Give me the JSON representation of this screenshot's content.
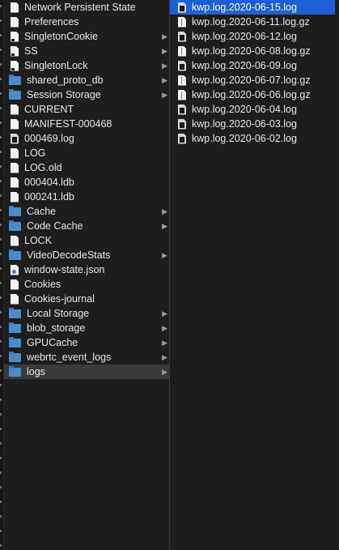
{
  "sidebar": {
    "items": [
      {
        "label": "Network Persistent State",
        "icon": "document-icon",
        "kind": "doc"
      },
      {
        "label": "Preferences",
        "icon": "document-icon",
        "kind": "doc"
      },
      {
        "label": "SingletonCookie",
        "icon": "alias-icon",
        "kind": "doc sym",
        "chevron": "▶"
      },
      {
        "label": "SS",
        "icon": "alias-icon",
        "kind": "doc sym",
        "chevron": "▶"
      },
      {
        "label": "SingletonLock",
        "icon": "alias-icon",
        "kind": "doc sym",
        "chevron": "▶"
      },
      {
        "label": "shared_proto_db",
        "icon": "folder-icon",
        "kind": "folder",
        "chevron": "▶"
      },
      {
        "label": "Session Storage",
        "icon": "folder-icon",
        "kind": "folder",
        "chevron": "▶"
      },
      {
        "label": "CURRENT",
        "icon": "document-icon",
        "kind": "doc"
      },
      {
        "label": "MANIFEST-000468",
        "icon": "document-icon",
        "kind": "doc"
      },
      {
        "label": "000469.log",
        "icon": "log-file-icon",
        "kind": "logfile"
      },
      {
        "label": "LOG",
        "icon": "document-icon",
        "kind": "doc"
      },
      {
        "label": "LOG.old",
        "icon": "document-icon",
        "kind": "doc"
      },
      {
        "label": "000404.ldb",
        "icon": "document-icon",
        "kind": "doc"
      },
      {
        "label": "000241.ldb",
        "icon": "document-icon",
        "kind": "doc"
      },
      {
        "label": "Cache",
        "icon": "folder-icon",
        "kind": "folder",
        "chevron": "▶"
      },
      {
        "label": "Code Cache",
        "icon": "folder-icon",
        "kind": "folder",
        "chevron": "▶"
      },
      {
        "label": "LOCK",
        "icon": "document-icon",
        "kind": "doc"
      },
      {
        "label": "VideoDecodeStats",
        "icon": "folder-icon",
        "kind": "folder",
        "chevron": "▶"
      },
      {
        "label": "window-state.json",
        "icon": "json-file-icon",
        "kind": "doc json"
      },
      {
        "label": "Cookies",
        "icon": "document-icon",
        "kind": "doc"
      },
      {
        "label": "Cookies-journal",
        "icon": "document-icon",
        "kind": "doc"
      },
      {
        "label": "Local Storage",
        "icon": "folder-icon",
        "kind": "folder",
        "chevron": "▶"
      },
      {
        "label": "blob_storage",
        "icon": "folder-icon",
        "kind": "folder",
        "chevron": "▶"
      },
      {
        "label": "GPUCache",
        "icon": "folder-icon",
        "kind": "folder",
        "chevron": "▶"
      },
      {
        "label": "webrtc_event_logs",
        "icon": "folder-icon",
        "kind": "folder",
        "chevron": "▶"
      },
      {
        "label": "logs",
        "icon": "folder-icon",
        "kind": "folder",
        "chevron": "▶",
        "selected": true
      }
    ]
  },
  "logs_column": {
    "items": [
      {
        "label": "kwp.log.2020-06-15.log",
        "icon": "log-file-icon",
        "kind": "logfile",
        "active": true
      },
      {
        "label": "kwp.log.2020-06-11.log.gz",
        "icon": "archive-icon",
        "kind": "doc gz"
      },
      {
        "label": "kwp.log.2020-06-12.log",
        "icon": "log-file-icon",
        "kind": "logfile"
      },
      {
        "label": "kwp.log.2020-06-08.log.gz",
        "icon": "archive-icon",
        "kind": "doc gz"
      },
      {
        "label": "kwp.log.2020-06-09.log",
        "icon": "log-file-icon",
        "kind": "logfile"
      },
      {
        "label": "kwp.log.2020-06-07.log.gz",
        "icon": "archive-icon",
        "kind": "doc gz"
      },
      {
        "label": "kwp.log.2020-06-06.log.gz",
        "icon": "archive-icon",
        "kind": "doc gz"
      },
      {
        "label": "kwp.log.2020-06-04.log",
        "icon": "log-file-icon",
        "kind": "logfile"
      },
      {
        "label": "kwp.log.2020-06-03.log",
        "icon": "log-file-icon",
        "kind": "logfile"
      },
      {
        "label": "kwp.log.2020-06-02.log",
        "icon": "log-file-icon",
        "kind": "logfile"
      }
    ]
  },
  "colors": {
    "background": "#1e1e1e",
    "selection_active": "#1c5fd6",
    "selection_inactive": "#3a3a3a",
    "folder": "#4a8cc7",
    "text": "#e6e6e6"
  }
}
